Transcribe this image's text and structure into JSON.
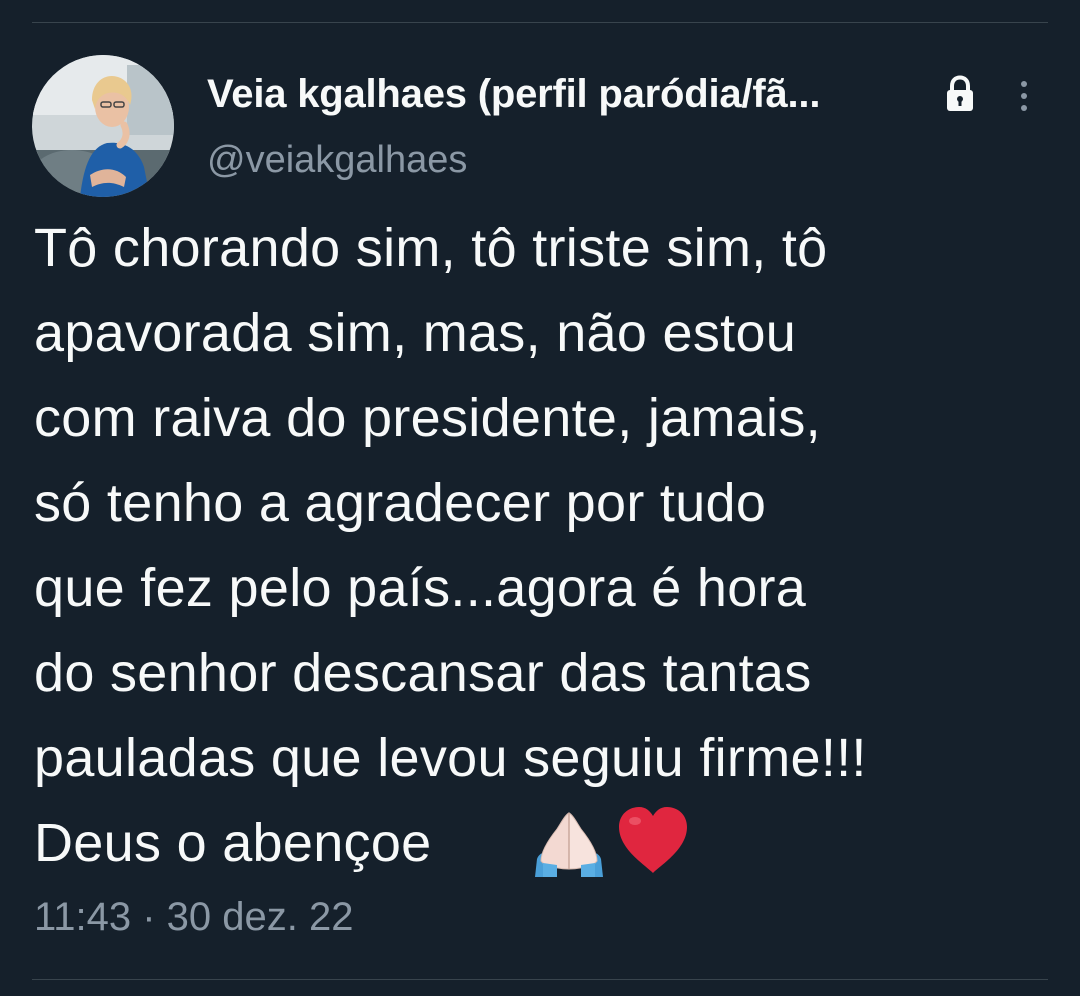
{
  "tweet": {
    "author": {
      "display_name": "Veia kgalhaes (perfil paródia/fã...",
      "handle": "@veiakgalhaes",
      "protected_icon": "lock-icon",
      "avatar": "profile-photo"
    },
    "menu_icon": "more-vertical-icon",
    "text_lines": [
      "Tô chorando sim, tô triste sim, tô",
      "apavorada sim, mas, não estou",
      "com raiva do presidente, jamais,",
      "só tenho a agradecer por tudo",
      "que fez pelo país...agora é hora",
      "do senhor descansar das tantas",
      "pauladas que levou seguiu firme!!!",
      "Deus o abençoe"
    ],
    "emojis": [
      "folded-hands-emoji",
      "red-heart-emoji"
    ],
    "timestamp": "11:43 · 30 dez. 22"
  },
  "colors": {
    "background": "#15202b",
    "primary_text": "#f7f9f9",
    "secondary_text": "#8b98a5",
    "divider": "#38444d",
    "heart": "#e0263f"
  }
}
